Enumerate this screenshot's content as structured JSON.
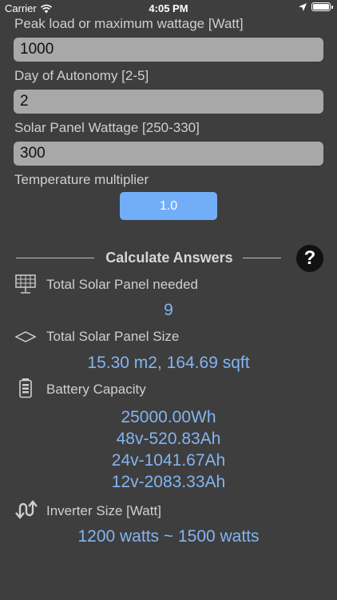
{
  "status_bar": {
    "carrier": "Carrier",
    "time": "4:05 PM"
  },
  "inputs": {
    "peak_load_label": "Peak load or maximum wattage [Watt]",
    "peak_load_value": "1000",
    "autonomy_label": "Day of Autonomy [2-5]",
    "autonomy_value": "2",
    "panel_wattage_label": "Solar Panel Wattage [250-330]",
    "panel_wattage_value": "300",
    "temperature_label": "Temperature multiplier",
    "temperature_value": "1.0"
  },
  "calculate": {
    "title": "Calculate Answers",
    "help_label": "?"
  },
  "results": {
    "panels_needed_label": "Total Solar Panel needed",
    "panels_needed_value": "9",
    "panel_size_label": "Total Solar Panel Size",
    "panel_size_value": "15.30 m2, 164.69 sqft",
    "battery_label": "Battery Capacity",
    "battery_values": [
      "25000.00Wh",
      "48v-520.83Ah",
      "24v-1041.67Ah",
      "12v-2083.33Ah"
    ],
    "inverter_label": "Inverter Size [Watt]",
    "inverter_value": "1200 watts ~ 1500 watts"
  },
  "colors": {
    "background": "#3e3e3e",
    "accent": "#72aef7",
    "result_text": "#82b5f2"
  }
}
